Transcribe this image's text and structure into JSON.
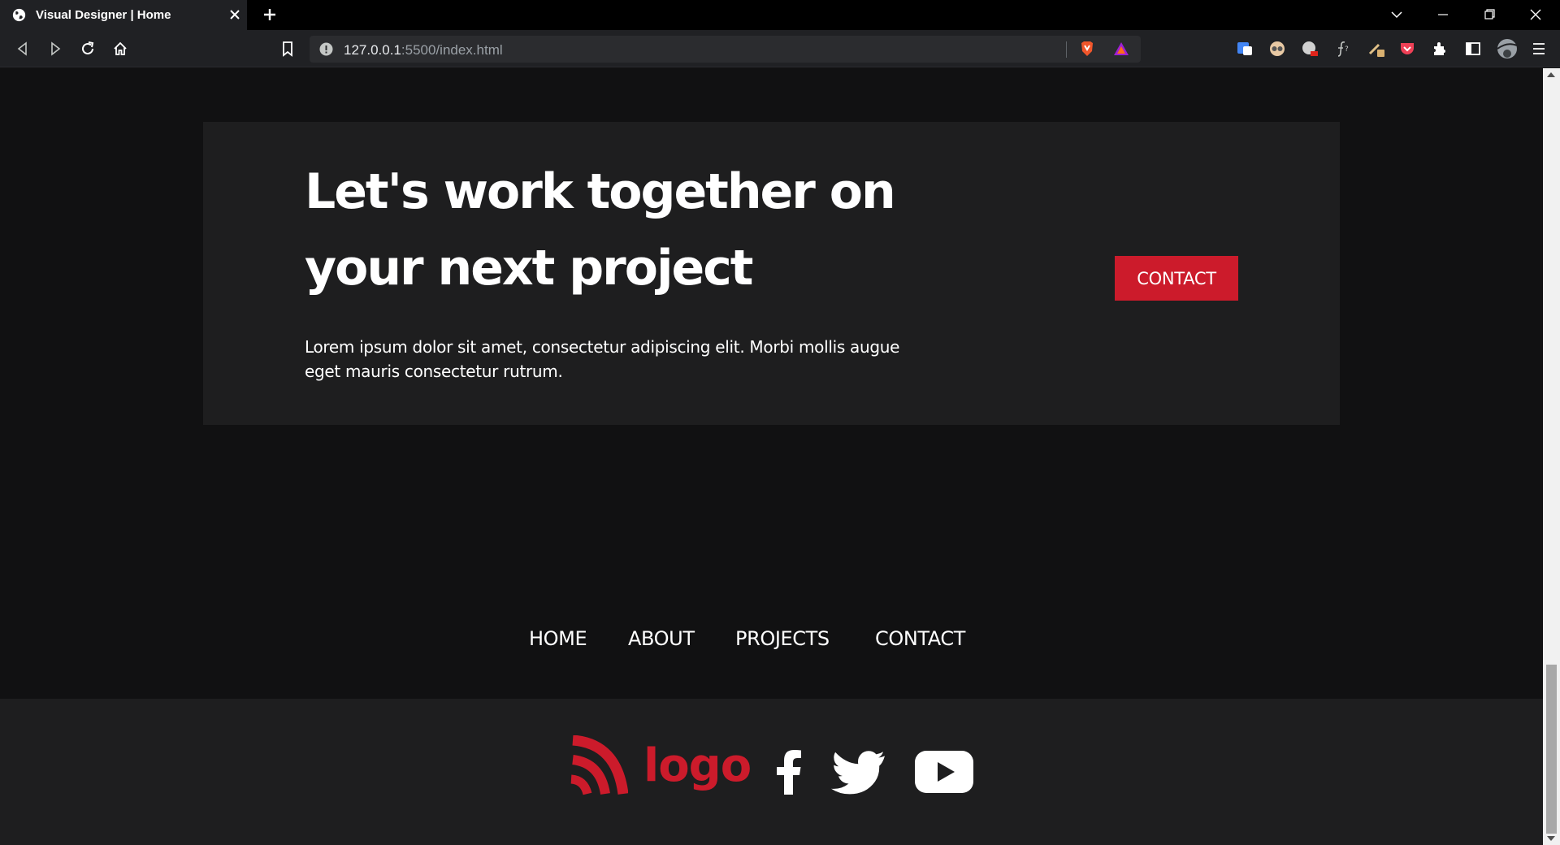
{
  "browser": {
    "tab_title": "Visual Designer | Home",
    "url_host": "127.0.0.1",
    "url_rest": ":5500/index.html"
  },
  "cta": {
    "heading_line1": "Let's work together on",
    "heading_line2": "your next project",
    "body_line1": "Lorem ipsum dolor sit amet, consectetur adipiscing elit. Morbi mollis augue",
    "body_line2": "eget mauris consectetur rutrum.",
    "button_label": "CONTACT"
  },
  "footer": {
    "nav": [
      "HOME",
      "ABOUT",
      "PROJECTS",
      "CONTACT"
    ],
    "logo_text": "logo",
    "social_icons": [
      "facebook-icon",
      "twitter-icon",
      "youtube-icon"
    ]
  },
  "colors": {
    "accent": "#cc1b2b",
    "page_bg": "#111112",
    "panel_bg": "#1e1e1f"
  }
}
